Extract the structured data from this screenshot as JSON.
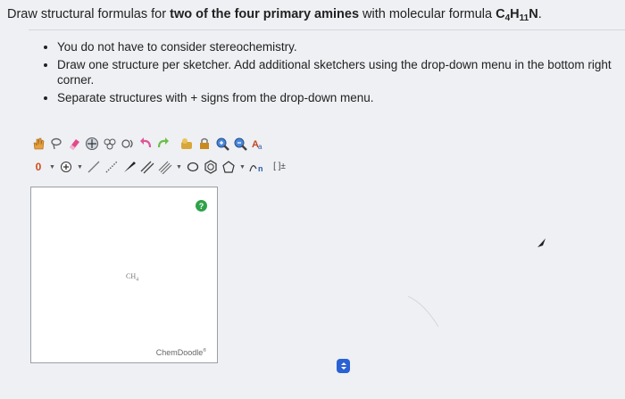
{
  "question": {
    "prefix": "Draw structural formulas for ",
    "bold": "two of the four primary amines",
    "middle": " with molecular formula ",
    "formula_c": "C",
    "formula_c_sub": "4",
    "formula_h": "H",
    "formula_h_sub": "11",
    "formula_n": "N",
    "period": "."
  },
  "notes": [
    "You do not have to consider stereochemistry.",
    "Draw one structure per sketcher. Add additional sketchers using the drop-down menu in the bottom right corner.",
    "Separate structures with + signs from the drop-down menu."
  ],
  "sketcher": {
    "help_label": "?",
    "canvas_molecule": "CH",
    "canvas_molecule_sub": "4",
    "brand": "ChemDoodle",
    "brand_mark": "®",
    "charge_label": "0",
    "brackets_label": "[ ]±",
    "sn_label": "n"
  },
  "colors": {
    "accent": "#2a62d4",
    "help_green": "#2fa24a"
  }
}
